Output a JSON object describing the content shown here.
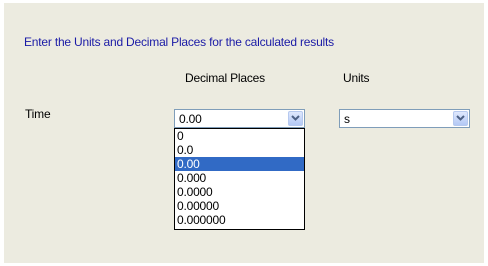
{
  "instruction": "Enter the Units and Decimal Places for the calculated results",
  "columns": {
    "decimal_places": "Decimal Places",
    "units": "Units"
  },
  "rows": [
    {
      "label": "Time",
      "decimal_places_value": "0.00",
      "units_value": "s"
    }
  ],
  "decimal_dropdown": {
    "options": [
      "0",
      "0.0",
      "0.00",
      "0.000",
      "0.0000",
      "0.00000",
      "0.000000"
    ],
    "selected": "0.00"
  },
  "icons": {
    "dropdown_arrow": "chevron-down-icon"
  },
  "colors": {
    "panel_background": "#ecebe0",
    "instruction_text": "#1a1aa6",
    "selection_highlight": "#316ac5",
    "combo_border": "#7f9db9"
  }
}
